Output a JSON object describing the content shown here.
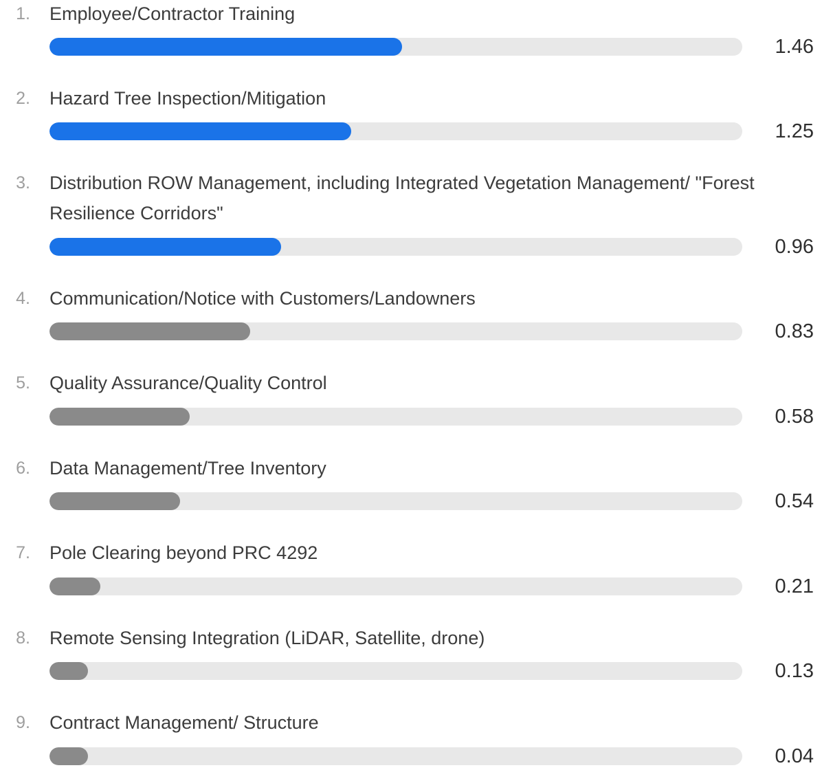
{
  "colors": {
    "top": "#1a73e8",
    "rest": "#8a8a8a",
    "track": "#e8e8e8"
  },
  "chart_data": {
    "type": "bar",
    "orientation": "horizontal",
    "max": 2.87,
    "highlight_count": 3,
    "items": [
      {
        "rank": "1.",
        "label": "Employee/Contractor Training",
        "value": 1.46,
        "value_label": "1.46"
      },
      {
        "rank": "2.",
        "label": "Hazard Tree Inspection/Mitigation",
        "value": 1.25,
        "value_label": "1.25"
      },
      {
        "rank": "3.",
        "label": "Distribution ROW Management, including Integrated Vegetation Management/ \"Forest Resilience Corridors\"",
        "value": 0.96,
        "value_label": "0.96"
      },
      {
        "rank": "4.",
        "label": "Communication/Notice with Customers/Landowners",
        "value": 0.83,
        "value_label": "0.83"
      },
      {
        "rank": "5.",
        "label": "Quality Assurance/Quality Control",
        "value": 0.58,
        "value_label": "0.58"
      },
      {
        "rank": "6.",
        "label": "Data Management/Tree Inventory",
        "value": 0.54,
        "value_label": "0.54"
      },
      {
        "rank": "7.",
        "label": "Pole Clearing beyond PRC 4292",
        "value": 0.21,
        "value_label": "0.21"
      },
      {
        "rank": "8.",
        "label": "Remote Sensing Integration (LiDAR, Satellite, drone)",
        "value": 0.13,
        "value_label": "0.13"
      },
      {
        "rank": "9.",
        "label": "Contract Management/ Structure",
        "value": 0.04,
        "value_label": "0.04"
      }
    ]
  }
}
